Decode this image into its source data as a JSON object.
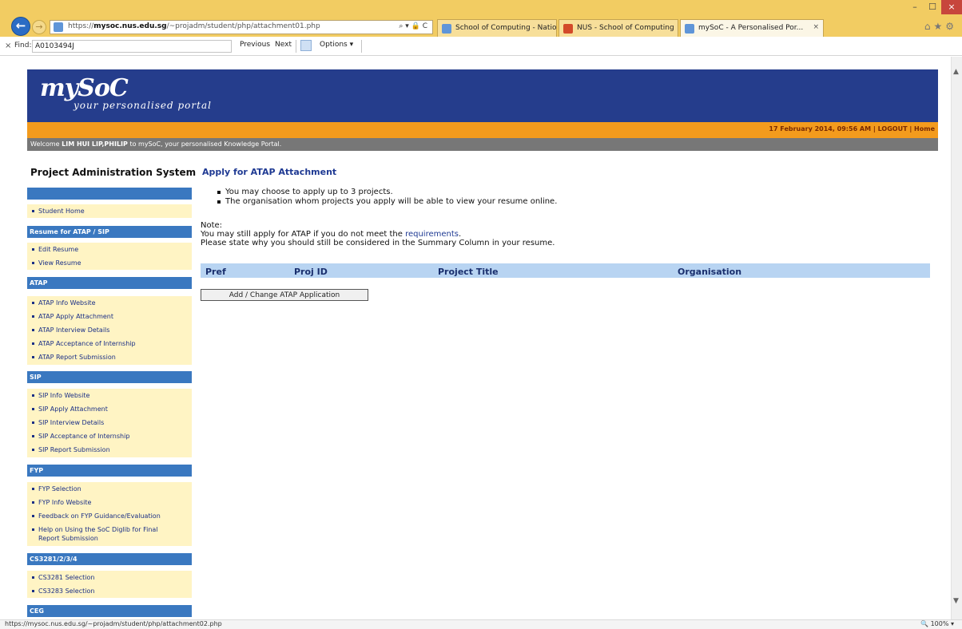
{
  "browser": {
    "url": "https://mysoc.nus.edu.sg/~projadm/student/php/attachment01.php",
    "url_host_bold": "mysoc.nus.edu.sg",
    "url_prefix": "https://",
    "url_suffix": "/~projadm/student/php/attachment01.php",
    "addr_icons": "⌕ ▾ 🔒 C",
    "tabs": [
      {
        "label": "School of Computing - Nation...",
        "active": false
      },
      {
        "label": "NUS - School of Computing",
        "active": false
      },
      {
        "label": "mySoC - A Personalised Por...",
        "active": true
      }
    ],
    "tab_close": "×",
    "window_buttons": {
      "minimize": "–",
      "maximize": "☐",
      "close": "×"
    },
    "fav_icons": "⌂★⚙",
    "back_arrow": "←",
    "forward_arrow": "→"
  },
  "findbar": {
    "close": "×",
    "label": "Find:",
    "value": "A0103494J",
    "previous": "Previous",
    "next": "Next",
    "options": "Options ▾"
  },
  "statusbar": {
    "url": "https://mysoc.nus.edu.sg/~projadm/student/php/attachment02.php",
    "zoom": "🔍 100%  ▾"
  },
  "scrollbar": {
    "up": "▲",
    "down": "▼"
  },
  "site": {
    "logo": "mySoC",
    "tagline": "your personalised portal",
    "date": "17 February 2014, 09:56 AM",
    "logout": "LOGOUT",
    "home": "Home",
    "separator": "|",
    "welcome_prefix": "Welcome ",
    "welcome_name": "LIM HUI LIP,PHILIP",
    "welcome_suffix": " to mySoC, your personalised Knowledge Portal."
  },
  "nav": {
    "title": "Project Administration System",
    "sections": [
      {
        "heading": "",
        "items": [
          "Student Home"
        ]
      },
      {
        "heading": "Resume for ATAP / SIP",
        "items": [
          "Edit Resume",
          "View Resume"
        ]
      },
      {
        "heading": "ATAP",
        "items": [
          "ATAP Info Website",
          "ATAP Apply Attachment",
          "ATAP Interview Details",
          "ATAP Acceptance of Internship",
          "ATAP Report Submission"
        ]
      },
      {
        "heading": "SIP",
        "items": [
          "SIP Info Website",
          "SIP Apply Attachment",
          "SIP Interview Details",
          "SIP Acceptance of Internship",
          "SIP Report Submission"
        ]
      },
      {
        "heading": "FYP",
        "items": [
          "FYP Selection",
          "FYP Info Website",
          "Feedback on FYP Guidance/Evaluation",
          "Help on Using the SoC Diglib for Final",
          "Report Submission"
        ]
      },
      {
        "heading": "CS3281/2/3/4",
        "items": [
          "CS3281 Selection",
          "CS3283 Selection"
        ]
      },
      {
        "heading": "CEG",
        "items": []
      }
    ]
  },
  "main": {
    "title": "Apply for ATAP Attachment",
    "bullets": [
      "You may choose to apply up to 3 projects.",
      "The organisation whom projects you apply will be able to view your resume online."
    ],
    "note_label": "Note:",
    "note_line1_prefix": "You may still apply for ATAP if you do not meet the ",
    "note_link": "requirements",
    "note_line1_suffix": ".",
    "note_line2": "Please state why you should still be considered in the Summary Column in your resume.",
    "table_headers": [
      "Pref",
      "Proj ID",
      "Project Title",
      "Organisation"
    ],
    "add_button": "Add / Change ATAP Application"
  }
}
